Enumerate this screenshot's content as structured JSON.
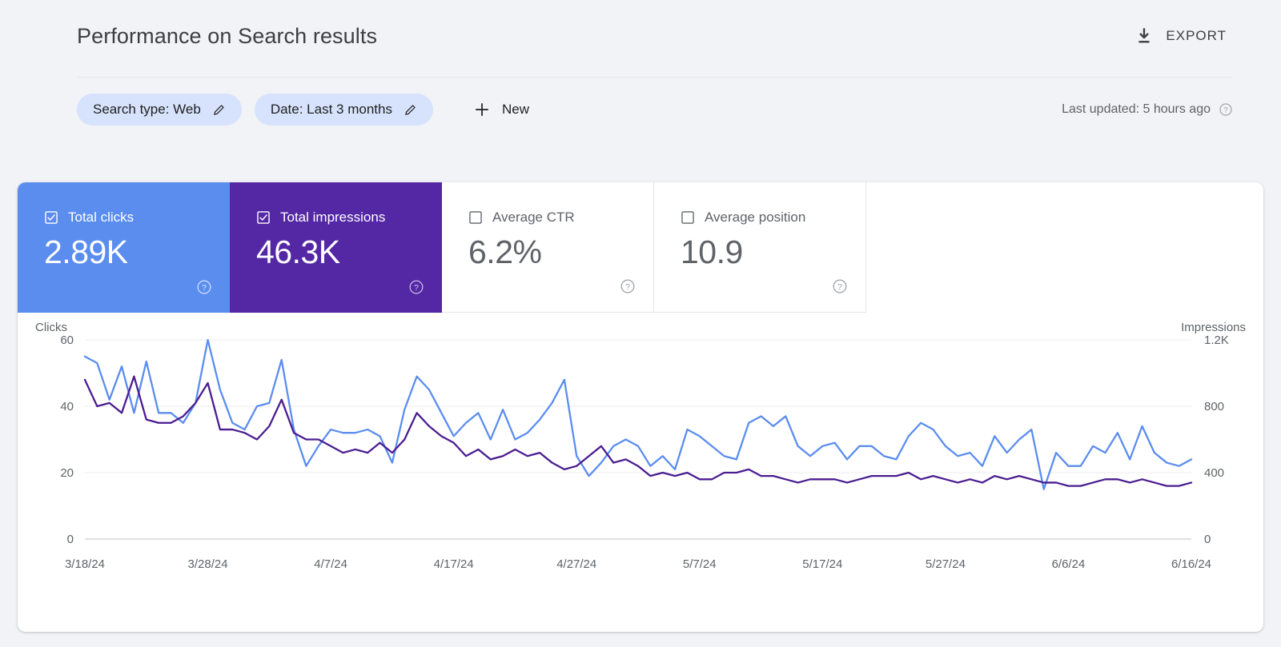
{
  "header": {
    "title": "Performance on Search results",
    "export_label": "EXPORT",
    "export_icon": "download-icon"
  },
  "filters": {
    "chips": [
      {
        "label": "Search type: Web",
        "icon": "pencil-icon"
      },
      {
        "label": "Date: Last 3 months",
        "icon": "pencil-icon"
      }
    ],
    "new_label": "New",
    "new_icon": "plus-icon",
    "last_updated": "Last updated: 5 hours ago",
    "help_icon": "help-icon"
  },
  "metrics": [
    {
      "name": "Total clicks",
      "value": "2.89K",
      "selected": true,
      "color": "#5b8def",
      "help_icon": "help-icon"
    },
    {
      "name": "Total impressions",
      "value": "46.3K",
      "selected": true,
      "color": "#5427a5",
      "help_icon": "help-icon"
    },
    {
      "name": "Average CTR",
      "value": "6.2%",
      "selected": false,
      "color": "#ffffff",
      "help_icon": "help-icon"
    },
    {
      "name": "Average position",
      "value": "10.9",
      "selected": false,
      "color": "#ffffff",
      "help_icon": "help-icon"
    }
  ],
  "chart_data": {
    "type": "line",
    "title": "",
    "xlabel": "",
    "ylabel": "Clicks",
    "y2label": "Impressions",
    "grid": true,
    "legend_position": "none",
    "x_tick_labels": [
      "3/18/24",
      "3/28/24",
      "4/7/24",
      "4/17/24",
      "4/27/24",
      "5/7/24",
      "5/17/24",
      "5/27/24",
      "6/6/24",
      "6/16/24"
    ],
    "x_tick_indices": [
      0,
      10,
      20,
      30,
      40,
      50,
      60,
      70,
      80,
      90
    ],
    "y_tick_labels": [
      "0",
      "20",
      "40",
      "60"
    ],
    "y_tick_values": [
      0,
      20,
      40,
      60
    ],
    "ylim": [
      0,
      60
    ],
    "y2_tick_labels": [
      "0",
      "400",
      "800",
      "1.2K"
    ],
    "y2_tick_values": [
      0,
      400,
      800,
      1200
    ],
    "y2lim": [
      0,
      1200
    ],
    "series": [
      {
        "name": "Total impressions",
        "color": "#5b8def",
        "axis": "right",
        "values": [
          1100,
          1060,
          840,
          1040,
          760,
          1070,
          760,
          760,
          700,
          820,
          1200,
          900,
          700,
          660,
          800,
          820,
          1080,
          660,
          440,
          560,
          660,
          640,
          640,
          660,
          620,
          460,
          780,
          980,
          900,
          760,
          620,
          700,
          760,
          600,
          780,
          600,
          640,
          720,
          820,
          960,
          500,
          380,
          460,
          560,
          600,
          560,
          440,
          500,
          420,
          660,
          620,
          560,
          500,
          480,
          700,
          740,
          680,
          740,
          560,
          500,
          560,
          580,
          480,
          560,
          560,
          500,
          480,
          620,
          700,
          660,
          560,
          500,
          520,
          440,
          620,
          520,
          600,
          660,
          300,
          520,
          440,
          440,
          560,
          520,
          640,
          480,
          680,
          520,
          460,
          440,
          480
        ]
      },
      {
        "name": "Total clicks",
        "color": "#4b1d91",
        "axis": "left",
        "values": [
          48,
          40,
          41,
          38,
          49,
          36,
          35,
          35,
          37,
          41,
          47,
          33,
          33,
          32,
          30,
          34,
          42,
          32,
          30,
          30,
          28,
          26,
          27,
          26,
          29,
          26,
          30,
          38,
          34,
          31,
          29,
          25,
          27,
          24,
          25,
          27,
          25,
          26,
          23,
          21,
          22,
          25,
          28,
          23,
          24,
          22,
          19,
          20,
          19,
          20,
          18,
          18,
          20,
          20,
          21,
          19,
          19,
          18,
          17,
          18,
          18,
          18,
          17,
          18,
          19,
          19,
          19,
          20,
          18,
          19,
          18,
          17,
          18,
          17,
          19,
          18,
          19,
          18,
          17,
          17,
          16,
          16,
          17,
          18,
          18,
          17,
          18,
          17,
          16,
          16,
          17
        ]
      }
    ]
  }
}
